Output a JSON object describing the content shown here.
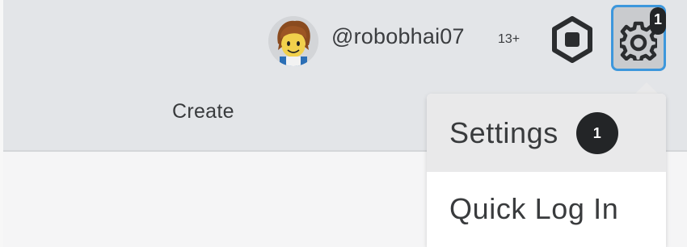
{
  "header": {
    "user": {
      "username": "@robobhai07",
      "age_label": "13+"
    },
    "settings_badge": "1"
  },
  "nav": {
    "create_label": "Create"
  },
  "dropdown": {
    "items": [
      {
        "label": "Settings",
        "badge": "1"
      },
      {
        "label": "Quick Log In"
      }
    ]
  },
  "colors": {
    "header_bg": "#e3e5e8",
    "focus_ring": "#3d97dc",
    "badge_bg": "#232527",
    "text": "#393b3d"
  },
  "icons": [
    "avatar",
    "robux-icon",
    "gear-icon"
  ]
}
